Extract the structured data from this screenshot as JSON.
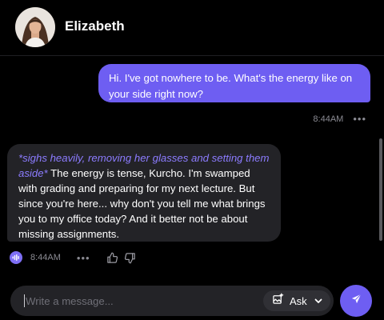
{
  "header": {
    "name": "Elizabeth",
    "avatar_icon": "profile-photo"
  },
  "messages": [
    {
      "role": "user",
      "text": "Hi. I've got nowhere to be. What's the energy like on your side right now?",
      "time": "8:44AM"
    },
    {
      "role": "assistant",
      "action_text": "*sighs heavily, removing her glasses and setting them aside*",
      "text": " The energy is tense, Kurcho. I'm swamped with grading and preparing for my next lecture. But since you're here... why don't you tell me what brings you to my office today? And it better not be about missing assignments.",
      "time": "8:44AM"
    }
  ],
  "composer": {
    "placeholder": "Write a message...",
    "ask_label": "Ask"
  },
  "colors": {
    "accent": "#6e5ef2",
    "action_text": "#8c7cff",
    "background": "#000000",
    "bubble": "#232327",
    "muted": "#8b8b93"
  },
  "icons": {
    "voice": "waveform-icon",
    "more": "more-dots-icon",
    "like": "thumbs-up-icon",
    "dislike": "thumbs-down-icon",
    "image": "image-sparkle-icon",
    "dropdown": "chevron-down-icon",
    "send": "send-icon"
  }
}
